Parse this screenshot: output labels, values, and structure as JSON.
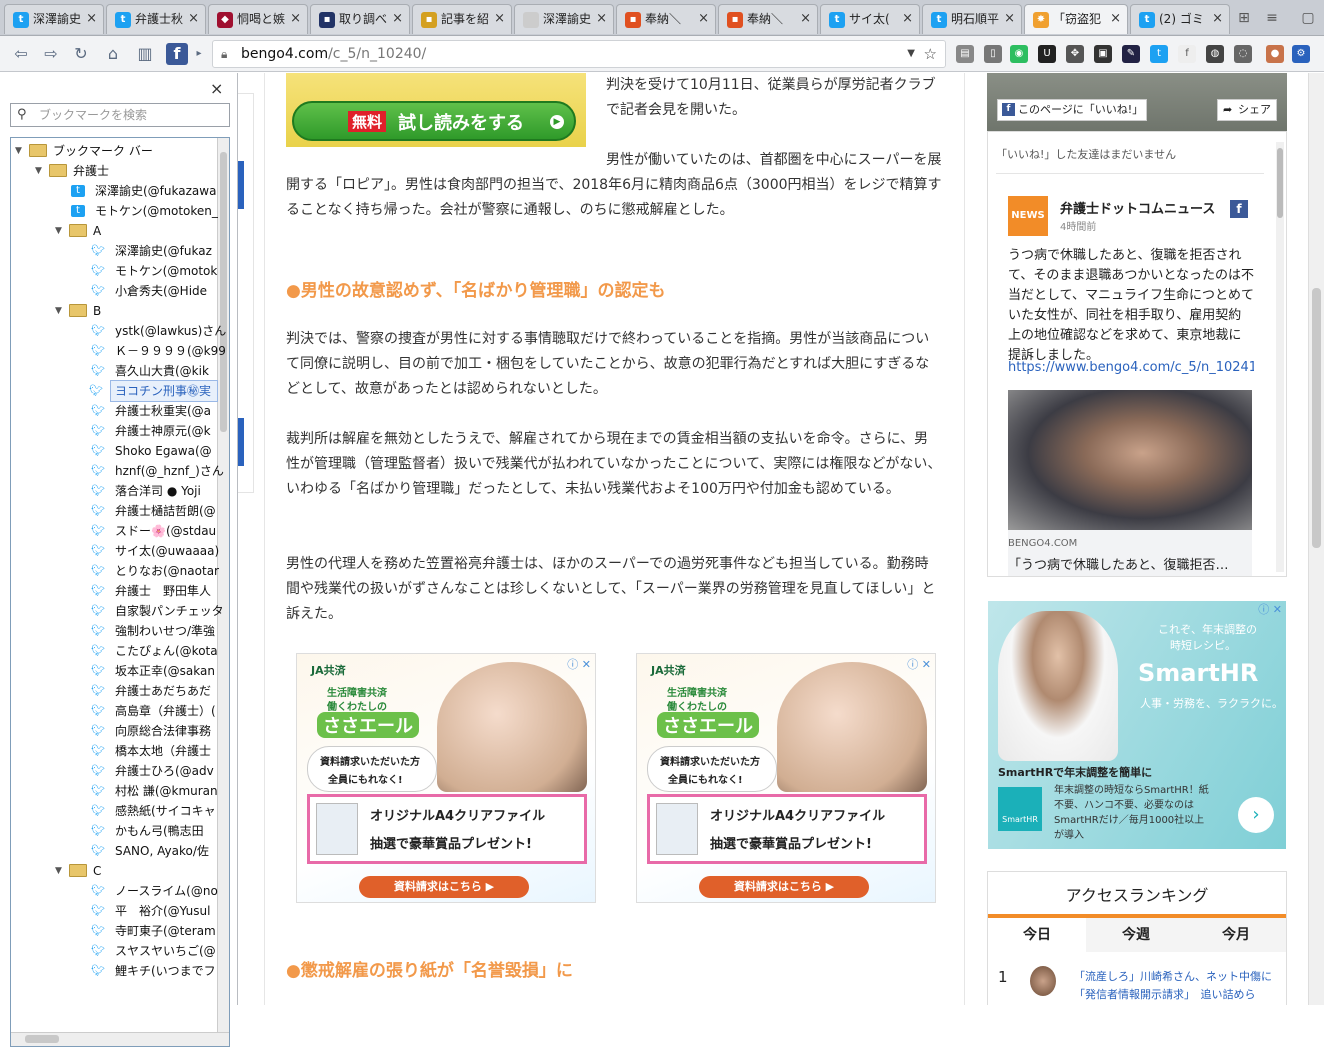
{
  "tabs": [
    {
      "label": "深澤諭史",
      "icon": "twitter-icon",
      "color": "#1da1f2"
    },
    {
      "label": "弁護士秋",
      "icon": "twitter-icon",
      "color": "#1da1f2"
    },
    {
      "label": "恫喝と嫉",
      "icon": "site-icon",
      "color": "#a01030"
    },
    {
      "label": "取り調べ",
      "icon": "site-icon",
      "color": "#223366"
    },
    {
      "label": "記事を紹",
      "icon": "site-icon",
      "color": "#d4a020"
    },
    {
      "label": "深澤諭史",
      "icon": "site-icon",
      "color": "#dddddd"
    },
    {
      "label": "奉納＼",
      "icon": "site-icon",
      "color": "#e05020"
    },
    {
      "label": "奉納＼",
      "icon": "site-icon",
      "color": "#e05020"
    },
    {
      "label": "サイ太(",
      "icon": "twitter-icon",
      "color": "#1da1f2"
    },
    {
      "label": "明石順平",
      "icon": "twitter-icon",
      "color": "#1da1f2"
    },
    {
      "label": "「窃盗犯",
      "icon": "site-icon",
      "color": "#f0a030"
    },
    {
      "label": "(2) ゴミ",
      "icon": "twitter-icon",
      "color": "#1da1f2"
    }
  ],
  "url": {
    "host": "bengo4.com",
    "path": "/c_5/n_10240/"
  },
  "sidebar": {
    "search_placeholder": "ブックマークを検索",
    "close": "×",
    "tree": [
      {
        "label": "ブックマーク バー",
        "type": "folder",
        "level": 0
      },
      {
        "label": "弁護士",
        "type": "folder",
        "level": 1
      },
      {
        "label": "深澤諭史(@fukazawa",
        "type": "item",
        "level": 2,
        "icon": "t"
      },
      {
        "label": "モトケン(@motoken_",
        "type": "item",
        "level": 2,
        "icon": "t"
      },
      {
        "label": "A",
        "type": "folder",
        "level": 2
      },
      {
        "label": "深澤諭史(@fukaz",
        "type": "item",
        "level": 3
      },
      {
        "label": "モトケン(@motok",
        "type": "item",
        "level": 3
      },
      {
        "label": "小倉秀夫(@Hide",
        "type": "item",
        "level": 3
      },
      {
        "label": "B",
        "type": "folder",
        "level": 2
      },
      {
        "label": "ystk(@lawkus)さん",
        "type": "item",
        "level": 3
      },
      {
        "label": "Ｋ－９９９９(@k99",
        "type": "item",
        "level": 3
      },
      {
        "label": "喜久山大貴(@kik",
        "type": "item",
        "level": 3
      },
      {
        "label": "ヨコチン刑事㊙実",
        "type": "item",
        "level": 3,
        "selected": true
      },
      {
        "label": "弁護士秋重実(@a",
        "type": "item",
        "level": 3
      },
      {
        "label": "弁護士神原元(@k",
        "type": "item",
        "level": 3
      },
      {
        "label": "Shoko Egawa(@",
        "type": "item",
        "level": 3
      },
      {
        "label": "hznf(@_hznf_)さん",
        "type": "item",
        "level": 3
      },
      {
        "label": "落合洋司 ● Yoji",
        "type": "item",
        "level": 3
      },
      {
        "label": "弁護士樋詰哲朗(@",
        "type": "item",
        "level": 3
      },
      {
        "label": "スドー🌸(@stdau",
        "type": "item",
        "level": 3
      },
      {
        "label": "サイ太(@uwaaaa)",
        "type": "item",
        "level": 3
      },
      {
        "label": "とりなお(@naotar",
        "type": "item",
        "level": 3
      },
      {
        "label": "弁護士　野田隼人",
        "type": "item",
        "level": 3
      },
      {
        "label": "自家製パンチェッタ",
        "type": "item",
        "level": 3
      },
      {
        "label": "強制わいせつ/準強",
        "type": "item",
        "level": 3
      },
      {
        "label": "こたぴょん(@kota",
        "type": "item",
        "level": 3
      },
      {
        "label": "坂本正幸(@sakan",
        "type": "item",
        "level": 3
      },
      {
        "label": "弁護士あだちあだ",
        "type": "item",
        "level": 3
      },
      {
        "label": "高島章（弁護士）(",
        "type": "item",
        "level": 3
      },
      {
        "label": "向原総合法律事務",
        "type": "item",
        "level": 3
      },
      {
        "label": "橋本太地（弁護士",
        "type": "item",
        "level": 3
      },
      {
        "label": "弁護士ひろ(@adv",
        "type": "item",
        "level": 3
      },
      {
        "label": "村松 謙(@kmuran",
        "type": "item",
        "level": 3
      },
      {
        "label": "感熱紙(サイコキャ",
        "type": "item",
        "level": 3
      },
      {
        "label": "かもん弓(鴨志田",
        "type": "item",
        "level": 3
      },
      {
        "label": "SANO, Ayako/佐",
        "type": "item",
        "level": 3
      },
      {
        "label": "C",
        "type": "folder",
        "level": 2
      },
      {
        "label": "ノースライム(@no",
        "type": "item",
        "level": 3
      },
      {
        "label": "平　裕介(@Yusul",
        "type": "item",
        "level": 3
      },
      {
        "label": "寺町東子(@teram",
        "type": "item",
        "level": 3
      },
      {
        "label": "スヤスヤいちご(@",
        "type": "item",
        "level": 3
      },
      {
        "label": "鯉キチ(いつまでフ",
        "type": "item",
        "level": 3
      }
    ]
  },
  "article": {
    "ad_top_label": "無料 試し読みをする",
    "ad_top_badge": "無料",
    "ad_top_text": "試し読みをする",
    "p0": "判決を受けて10月11日、従業員らが厚労記者クラブで記者会見を開いた。",
    "p1": "男性が働いていたのは、首都圏を中心にスーパーを展開する「ロピア」。男性は食肉部門の担当で、2018年6月に精肉商品6点（3000円相当）をレジで精算することなく持ち帰った。会社が警察に通報し、のちに懲戒解雇とした。",
    "h1": "●男性の故意認めず、「名ばかり管理職」の認定も",
    "p2": "判決では、警察の捜査が男性に対する事情聴取だけで終わっていることを指摘。男性が当該商品について同僚に説明し、目の前で加工・梱包をしていたことから、故意の犯罪行為だとすれば大胆にすぎるなどとして、故意があったとは認められないとした。",
    "p3": "裁判所は解雇を無効としたうえで、解雇されてから現在までの賃金相当額の支払いを命令。さらに、男性が管理職（管理監督者）扱いで残業代が払われていなかったことについて、実際には権限などがない、いわゆる「名ばかり管理職」だったとして、未払い残業代およそ100万円や付加金も認めている。",
    "p4": "男性の代理人を務めた笠置裕亮弁護士は、ほかのスーパーでの過労死事件なども担当している。勤務時間や残業代の扱いがずさんなことは珍しくないとして、「スーパー業界の労務管理を見直してほしい」と訴えた。",
    "h2": "●懲戒解雇の張り紙が「名誉毀損」に"
  },
  "ja_ad": {
    "brand": "JA共済",
    "line1": "生活障害共済",
    "line2": "働くわたしの",
    "logo": "ささエール",
    "req1": "資料請求いただいた方",
    "req2": "全員にもれなく!",
    "gift1": "オリジナルA4クリアファイル",
    "gift2": "抽選で豪華賞品プレゼント!",
    "cta": "資料請求はこちら ▶"
  },
  "fb": {
    "like_button": "このページに「いいね!」",
    "share_button": "シェア",
    "no_friends": "「いいね!」した友達はまだいません",
    "page_name": "弁護士ドットコムニュース",
    "time": "4時間前",
    "post": "うつ病で休職したあと、復職を拒否されて、そのまま退職あつかいとなったのは不当だとして、マニュライフ生命につとめていた女性が、同社を相手取り、雇用契約上の地位確認などを求めて、東京地裁に提訴しました。",
    "link": "https://www.bengo4.com/c_5/n_10241/",
    "link_domain": "BENGO4.COM",
    "link_title": "「うつ病で休職したあと、復職拒否…"
  },
  "smarthr": {
    "tagline1": "これぞ、年末調整の",
    "tagline2": "時短レシピ。",
    "brand": "SmartHR",
    "sub": "人事・労務を、ラクラクに。",
    "headline": "SmartHRで年末調整を簡単に",
    "body": "年末調整の時短ならSmartHR！紙不要、ハンコ不要、必要なのはSmartHRだけ／毎月1000社以上が導入",
    "logo_small": "SmartHR"
  },
  "ranking": {
    "title": "アクセスランキング",
    "tabs": [
      "今日",
      "今週",
      "今月"
    ],
    "first_rank": "1",
    "first_text1": "「流産しろ」川崎希さん、ネット中傷に",
    "first_text2": "「発信者情報開示請求」　追い詰めら"
  },
  "colors": {
    "accent": "#f2994a",
    "link": "#2a62bd",
    "twitter": "#1da1f2",
    "fb": "#3b5998"
  }
}
